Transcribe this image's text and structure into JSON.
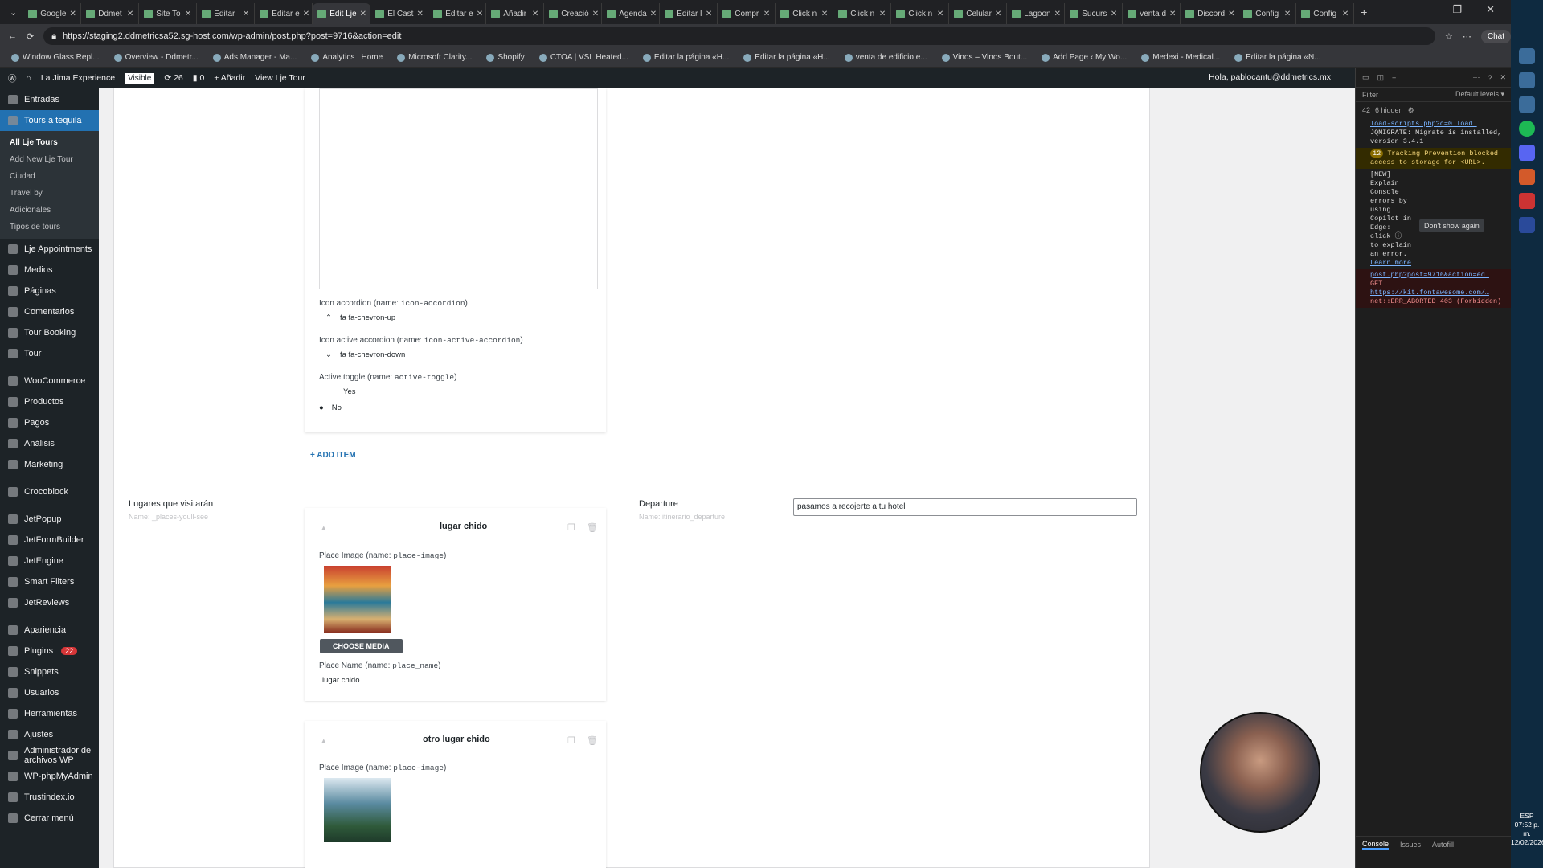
{
  "tabs": [
    {
      "label": "Google"
    },
    {
      "label": "Ddmet"
    },
    {
      "label": "Site To"
    },
    {
      "label": "Editar"
    },
    {
      "label": "Editar e"
    },
    {
      "label": "Edit Lje",
      "active": true
    },
    {
      "label": "El Cast"
    },
    {
      "label": "Editar e"
    },
    {
      "label": "Añadir"
    },
    {
      "label": "Creació"
    },
    {
      "label": "Agenda"
    },
    {
      "label": "Editar l"
    },
    {
      "label": "Compr"
    },
    {
      "label": "Click n"
    },
    {
      "label": "Click n"
    },
    {
      "label": "Click n"
    },
    {
      "label": "Celular"
    },
    {
      "label": "Lagoon"
    },
    {
      "label": "Sucurs"
    },
    {
      "label": "venta d"
    },
    {
      "label": "Discord"
    },
    {
      "label": "Config"
    },
    {
      "label": "Config"
    }
  ],
  "address": {
    "url": "https://staging2.ddmetricsa52.sg-host.com/wp-admin/post.php?post=9716&action=edit",
    "chat_label": "Chat"
  },
  "bookmarks": [
    "Window Glass Repl...",
    "Overview - Ddmetr...",
    "Ads Manager - Ma...",
    "Analytics | Home",
    "Microsoft Clarity...",
    "Shopify",
    "CTOA | VSL Heated...",
    "Editar la página «H...",
    "Editar la página «H...",
    "venta de edificio e...",
    "Vinos – Vinos Bout...",
    "Add Page ‹ My Wo...",
    "Medexi - Medical...",
    "Editar la página «N..."
  ],
  "adminbar": {
    "site": "La Jima Experience",
    "visible": "Visible",
    "updates": "26",
    "comments": "0",
    "add_new": "Añadir",
    "view": "View Lje Tour",
    "howdy": "Hola, pablocantu@ddmetrics.mx"
  },
  "sidebar": {
    "items_top": [
      {
        "label": "Entradas"
      }
    ],
    "active": {
      "label": "Tours a tequila"
    },
    "submenu": [
      {
        "label": "All Lje Tours",
        "current": true
      },
      {
        "label": "Add New Lje Tour"
      },
      {
        "label": "Ciudad"
      },
      {
        "label": "Travel by"
      },
      {
        "label": "Adicionales"
      },
      {
        "label": "Tipos de tours"
      }
    ],
    "items_mid": [
      {
        "label": "Lje Appointments"
      },
      {
        "label": "Medios"
      },
      {
        "label": "Páginas"
      },
      {
        "label": "Comentarios"
      },
      {
        "label": "Tour Booking"
      },
      {
        "label": "Tour"
      }
    ],
    "items_woo": [
      {
        "label": "WooCommerce"
      },
      {
        "label": "Productos"
      },
      {
        "label": "Pagos"
      },
      {
        "label": "Análisis"
      },
      {
        "label": "Marketing"
      }
    ],
    "items_croco": [
      {
        "label": "Crocoblock"
      }
    ],
    "items_jet": [
      {
        "label": "JetPopup"
      },
      {
        "label": "JetFormBuilder"
      },
      {
        "label": "JetEngine"
      },
      {
        "label": "Smart Filters"
      },
      {
        "label": "JetReviews"
      }
    ],
    "items_bottom": [
      {
        "label": "Apariencia"
      },
      {
        "label": "Plugins",
        "badge": "22"
      },
      {
        "label": "Snippets"
      },
      {
        "label": "Usuarios"
      },
      {
        "label": "Herramientas"
      },
      {
        "label": "Ajustes"
      },
      {
        "label": "Administrador de archivos WP"
      },
      {
        "label": "WP-phpMyAdmin"
      },
      {
        "label": "Trustindex.io"
      },
      {
        "label": "Cerrar menú"
      }
    ]
  },
  "accordion": {
    "icon_label": "Icon accordion (name: ",
    "icon_code": "icon-accordion",
    "icon_value": "fa fa-chevron-up",
    "icon_active_label": "Icon active accordion (name: ",
    "icon_active_code": "icon-active-accordion",
    "icon_active_value": "fa fa-chevron-down",
    "toggle_label": "Active toggle (name: ",
    "toggle_code": "active-toggle",
    "opt_yes": "Yes",
    "opt_no": "No",
    "add_item": "ADD ITEM"
  },
  "places": {
    "title": "Lugares que visitarán",
    "name": "Name: _places-youll-see",
    "items": [
      {
        "title": "lugar chido",
        "image_label": "Place Image (name: ",
        "image_code": "place-image",
        "choose": "CHOOSE MEDIA",
        "name_label": "Place Name (name: ",
        "name_code": "place_name",
        "name_value": "lugar chido"
      },
      {
        "title": "otro lugar chido",
        "image_label": "Place Image (name: ",
        "image_code": "place-image"
      }
    ]
  },
  "departure": {
    "title": "Departure",
    "name": "Name: itinerario_departure",
    "value": "pasamos a recojerte a tu hotel"
  },
  "devtools": {
    "filter": "Filter",
    "levels": "Default levels ▾",
    "count": "42",
    "hidden": "6 hidden",
    "msg1_link": "load-scripts.php?c=0…load…",
    "msg1": "JQMIGRATE: Migrate is installed, version 3.4.1",
    "warn_badge": "12",
    "warn": "Tracking Prevention blocked access to storage for <URL>.",
    "info": "[NEW] Explain Console errors by using Copilot in Edge: click",
    "info2": "to explain an error.",
    "learn": "Learn more",
    "dont_show": "Don't show again",
    "err_link": "post.php?post=9716&action=ed…",
    "err_get": "GET",
    "err_url": "https://kit.fontawesome.com/…",
    "err_text": "net::ERR_ABORTED 403 (Forbidden)",
    "tab_console": "Console",
    "tab_issues": "Issues",
    "tab_autofill": "Autofill"
  },
  "clock": {
    "time": "07:52 p. m.",
    "date": "12/02/2026",
    "lang": "ESP"
  }
}
